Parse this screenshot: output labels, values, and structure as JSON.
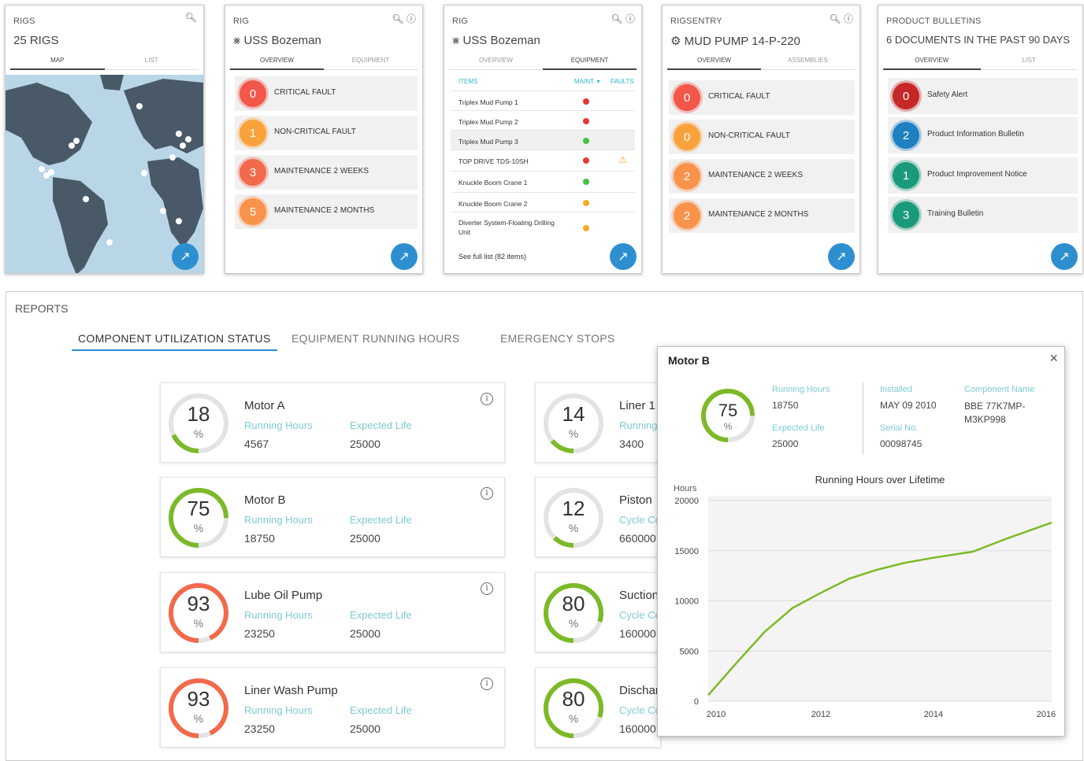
{
  "rigs_card": {
    "title": "RIGS",
    "count": "25 RIGS",
    "tabs": [
      "MAP",
      "LIST"
    ],
    "search_icon": "search-icon",
    "external_icon": "external-link-icon"
  },
  "rig_card": {
    "title": "RIG",
    "name": "USS Bozeman",
    "tabs": [
      "OVERVIEW",
      "EQUIPMENT"
    ],
    "rows": [
      {
        "count": "0",
        "label": "CRITICAL FAULT",
        "color": "#f2574a"
      },
      {
        "count": "1",
        "label": "NON-CRITICAL FAULT",
        "color": "#f9a23c"
      },
      {
        "count": "3",
        "label": "MAINTENANCE 2 WEEKS",
        "color": "#f26a4b"
      },
      {
        "count": "5",
        "label": "MAINTENANCE 2 MONTHS",
        "color": "#f9934b"
      }
    ]
  },
  "equipment_card": {
    "title": "RIG",
    "name": "USS Bozeman",
    "tabs": [
      "OVERVIEW",
      "EQUIPMENT"
    ],
    "col_items": "ITEMS",
    "col_maint": "MAINT. ▾",
    "col_faults": "FAULTS",
    "items": [
      {
        "name": "Triplex Mud Pump 1",
        "status": "#e53935",
        "fault": ""
      },
      {
        "name": "Triplex Mud Pump 2",
        "status": "#e53935",
        "fault": ""
      },
      {
        "name": "Triplex Mud Pump 3",
        "status": "#43c243",
        "fault": ""
      },
      {
        "name": "TOP DRIVE TDS-10SH",
        "status": "#e53935",
        "fault": "⚠"
      },
      {
        "name": "Knuckle Boom Crane 1",
        "status": "#43c243",
        "fault": ""
      },
      {
        "name": "Knuckle Boom Crane 2",
        "status": "#f9a825",
        "fault": ""
      },
      {
        "name": "Diverter System-Floating Drilling Unit",
        "status": "#f9a825",
        "fault": ""
      }
    ],
    "see_full": "See full list (82 items)"
  },
  "rigsentry_card": {
    "title": "RIGSENTRY",
    "name": "MUD PUMP 14-P-220",
    "tabs": [
      "OVERVIEW",
      "ASSEMBLIES"
    ],
    "rows": [
      {
        "count": "0",
        "label": "CRITICAL FAULT",
        "color": "#f2574a"
      },
      {
        "count": "0",
        "label": "NON-CRITICAL FAULT",
        "color": "#f9a23c"
      },
      {
        "count": "2",
        "label": "MAINTENANCE 2 WEEKS",
        "color": "#f9934b"
      },
      {
        "count": "2",
        "label": "MAINTENANCE 2 MONTHS",
        "color": "#f9934b"
      }
    ]
  },
  "bulletins_card": {
    "title": "PRODUCT BULLETINS",
    "subtitle": "6 DOCUMENTS IN THE PAST 90 DAYS",
    "tabs": [
      "OVERVIEW",
      "LIST"
    ],
    "rows": [
      {
        "count": "0",
        "label": "Safety Alert",
        "color": "#c62828"
      },
      {
        "count": "2",
        "label": "Product Information Bulletin",
        "color": "#1e7fc1"
      },
      {
        "count": "1",
        "label": "Product Improvement Notice",
        "color": "#1a9a7c"
      },
      {
        "count": "3",
        "label": "Training Bulletin",
        "color": "#1a9a7c"
      }
    ]
  },
  "reports": {
    "title": "REPORTS",
    "tabs": [
      "COMPONENT UTILIZATION STATUS",
      "EQUIPMENT RUNNING HOURS",
      "EMERGENCY STOPS"
    ]
  },
  "utilization": [
    {
      "pct": "18",
      "pct_val": 18,
      "sign": "%",
      "name": "Motor A",
      "l1": "Running Hours",
      "v1": "4567",
      "l2": "Expected Life",
      "v2": "25000",
      "color": "#7cb928"
    },
    {
      "pct": "75",
      "pct_val": 75,
      "sign": "%",
      "name": "Motor B",
      "l1": "Running Hours",
      "v1": "18750",
      "l2": "Expected Life",
      "v2": "25000",
      "color": "#7cb928"
    },
    {
      "pct": "93",
      "pct_val": 93,
      "sign": "%",
      "name": "Lube Oil Pump",
      "l1": "Running Hours",
      "v1": "23250",
      "l2": "Expected Life",
      "v2": "25000",
      "color": "#f26a4b"
    },
    {
      "pct": "93",
      "pct_val": 93,
      "sign": "%",
      "name": "Liner Wash Pump",
      "l1": "Running Hours",
      "v1": "23250",
      "l2": "Expected Life",
      "v2": "25000",
      "color": "#f26a4b"
    },
    {
      "pct": "14",
      "pct_val": 14,
      "sign": "%",
      "name": "Liner 1",
      "l1": "Running",
      "v1": "3400",
      "color": "#7cb928"
    },
    {
      "pct": "12",
      "pct_val": 12,
      "sign": "%",
      "name": "Piston",
      "l1": "Cycle Co",
      "v1": "660000",
      "color": "#7cb928"
    },
    {
      "pct": "80",
      "pct_val": 80,
      "sign": "%",
      "name": "Suction",
      "l1": "Cycle Co",
      "v1": "160000",
      "color": "#7cb928"
    },
    {
      "pct": "80",
      "pct_val": 80,
      "sign": "%",
      "name": "Dischar",
      "l1": "Cycle Co",
      "v1": "160000",
      "color": "#7cb928"
    }
  ],
  "popup": {
    "title": "Motor B",
    "close": "×",
    "pct": "75",
    "pct_val": 75,
    "sign": "%",
    "running_hours_label": "Running Hours",
    "running_hours": "18750",
    "expected_life_label": "Expected Life",
    "expected_life": "25000",
    "installed_label": "Installed",
    "installed": "MAY 09 2010",
    "serial_label": "Serial No.",
    "serial": "00098745",
    "component_label": "Component Name",
    "component": "BBE 77K7MP-M3KP998"
  },
  "chart_data": {
    "type": "line",
    "title": "Running Hours over Lifetime",
    "ylabel": "Hours",
    "xlabel": "",
    "x": [
      2010,
      2010.5,
      2011,
      2011.5,
      2012,
      2012.5,
      2013,
      2013.5,
      2014,
      2014.7,
      2015.3,
      2016.1
    ],
    "y": [
      600,
      3800,
      6900,
      9300,
      10800,
      12200,
      13100,
      13800,
      14300,
      14900,
      16200,
      17800
    ],
    "xticks": [
      "2010",
      "2012",
      "2014",
      "2016"
    ],
    "yticks": [
      "0",
      "5000",
      "10000",
      "15000",
      "20000"
    ],
    "xlim": [
      2010,
      2016.1
    ],
    "ylim": [
      0,
      20000
    ],
    "grid": true,
    "color": "#7cb928"
  }
}
